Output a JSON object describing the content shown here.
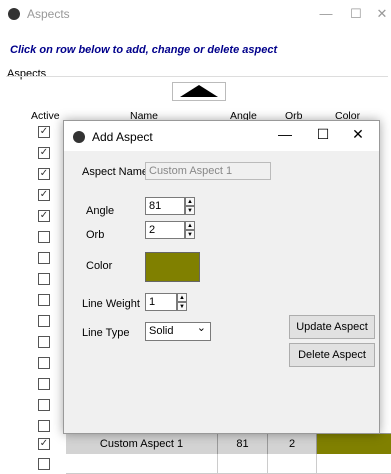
{
  "window": {
    "title": "Aspects",
    "minimize": "—",
    "maximize": "☐",
    "close": "✕"
  },
  "instruction": "Click on row below to add, change or delete aspect",
  "group_label": "Aspects",
  "columns": {
    "active": "Active",
    "name": "Name",
    "angle": "Angle",
    "orb": "Orb",
    "color": "Color"
  },
  "rows_active": [
    true,
    true,
    true,
    true,
    true,
    false,
    false,
    false,
    false,
    false,
    false,
    false,
    false,
    false,
    false,
    false,
    true,
    false
  ],
  "check_glyph": "✓",
  "grid_row": {
    "name": "Custom Aspect 1",
    "angle": "81",
    "orb": "2",
    "color": "#808000"
  },
  "dialog": {
    "title": "Add Aspect",
    "minimize": "—",
    "maximize": "☐",
    "close": "✕",
    "aspect_name_label": "Aspect Name",
    "aspect_name_value": "Custom Aspect 1",
    "angle_label": "Angle",
    "angle_value": "81",
    "orb_label": "Orb",
    "orb_value": "2",
    "color_label": "Color",
    "color_value": "#808000",
    "line_weight_label": "Line Weight",
    "line_weight_value": "1",
    "line_type_label": "Line Type",
    "line_type_value": "Solid",
    "update_button": "Update Aspect",
    "delete_button": "Delete Aspect",
    "spin_up": "▲",
    "spin_down": "▼",
    "dropdown_arrow": "⌄"
  }
}
